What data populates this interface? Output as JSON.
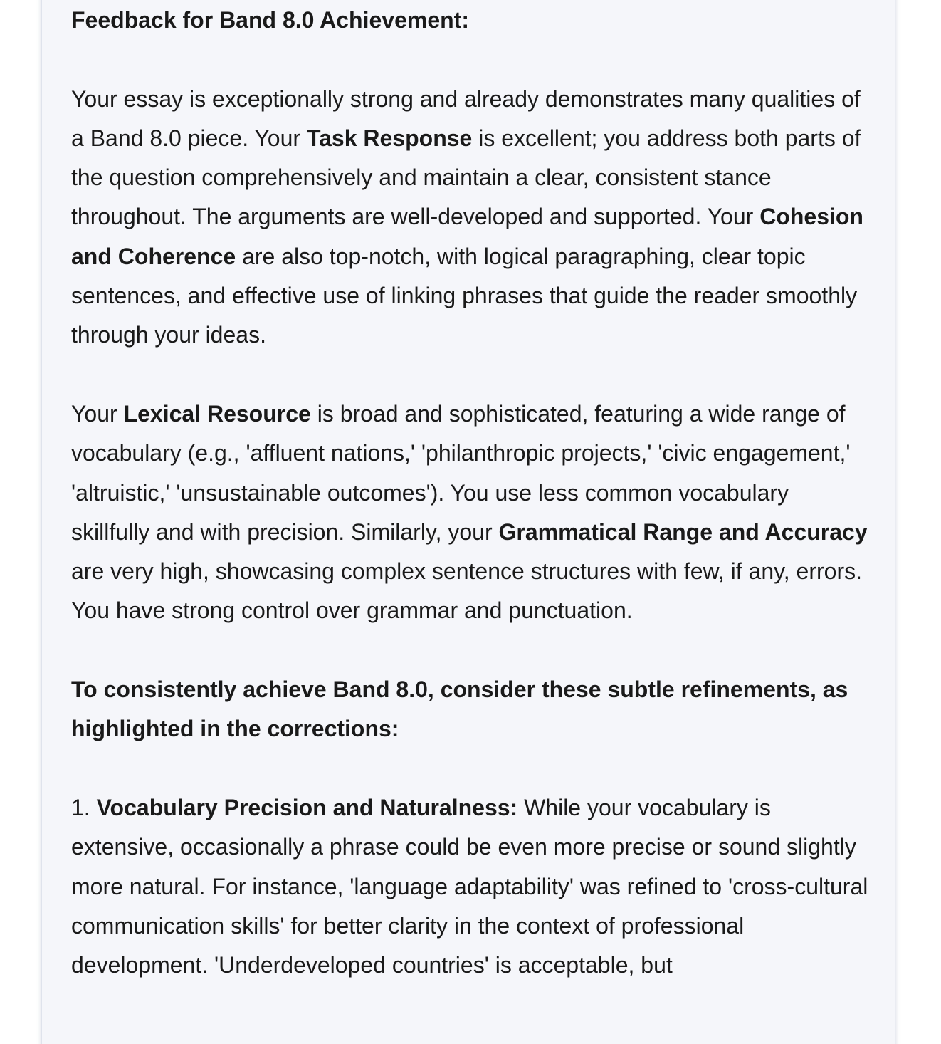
{
  "feedback": {
    "heading": "Feedback for Band 8.0 Achievement:",
    "para1": {
      "t1": "Your essay is exceptionally strong and already demonstrates many qualities of a Band 8.0 piece. Your ",
      "b1": "Task Response",
      "t2": " is excellent; you address both parts of the question comprehensively and maintain a clear, consistent stance throughout. The arguments are well-developed and supported. Your ",
      "b2": "Cohesion and Coherence",
      "t3": " are also top-notch, with logical paragraphing, clear topic sentences, and effective use of linking phrases that guide the reader smoothly through your ideas."
    },
    "para2": {
      "t1": "Your ",
      "b1": "Lexical Resource",
      "t2": " is broad and sophisticated, featuring a wide range of vocabulary (e.g., 'affluent nations,' 'philanthropic projects,' 'civic engagement,' 'altruistic,' 'unsustainable outcomes'). You use less common vocabulary skillfully and with precision. Similarly, your ",
      "b2": "Grammatical Range and Accuracy",
      "t3": " are very high, showcasing complex sentence structures with few, if any, errors. You have strong control over grammar and punctuation."
    },
    "refinements_heading": "To consistently achieve Band 8.0, consider these subtle refinements, as highlighted in the corrections:",
    "item1": {
      "number": "1. ",
      "title": "Vocabulary Precision and Naturalness:",
      "text": " While your vocabulary is extensive, occasionally a phrase could be even more precise or sound slightly more natural. For instance, 'language adaptability' was refined to 'cross-cultural communication skills' for better clarity in the context of professional development. 'Underdeveloped countries' is acceptable, but"
    }
  }
}
